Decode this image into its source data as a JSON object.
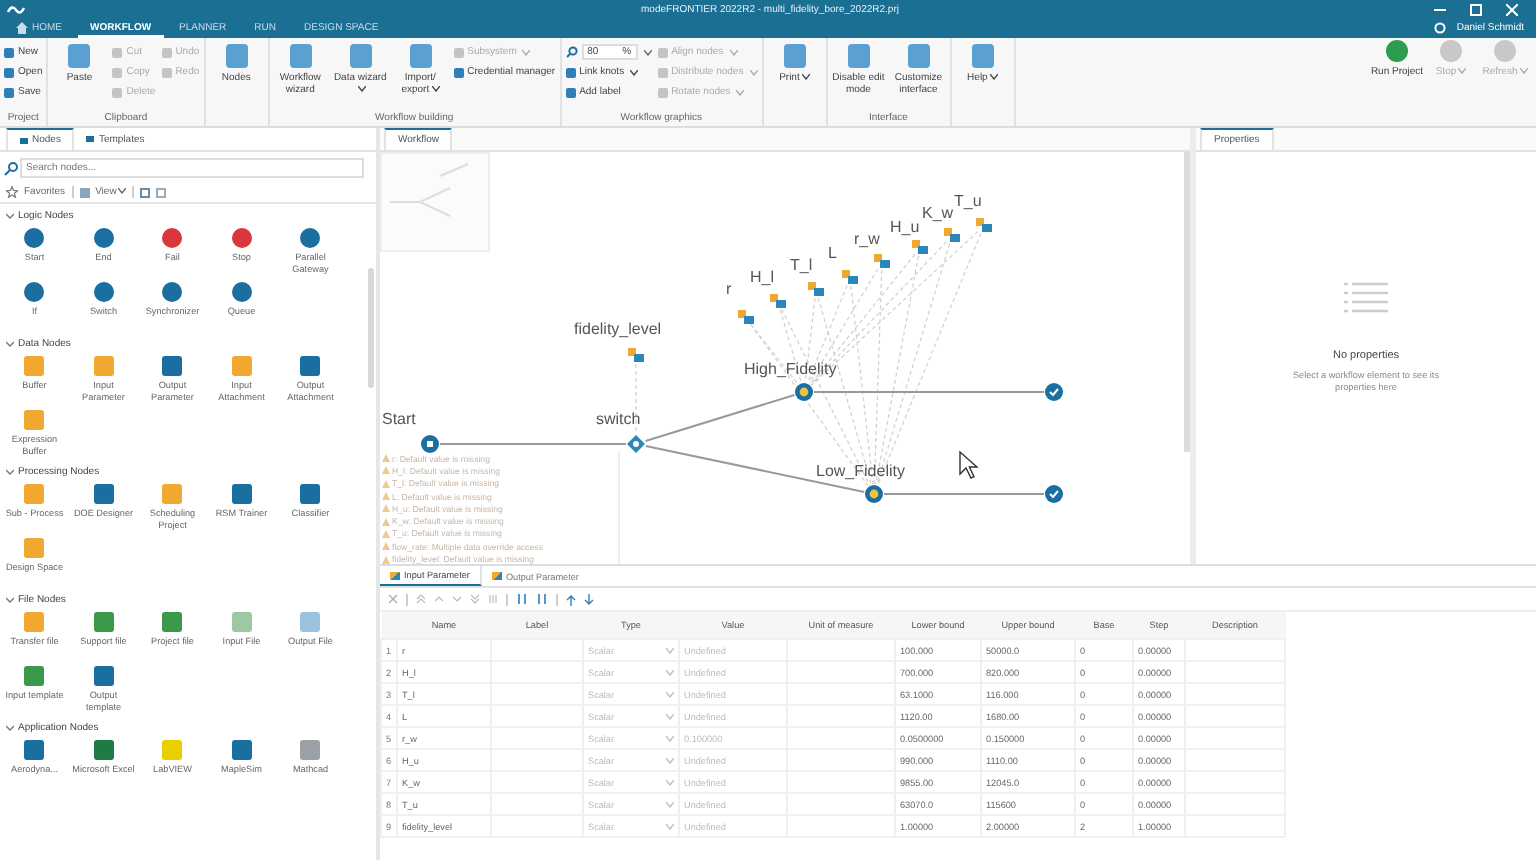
{
  "window": {
    "title": "modeFRONTIER 2022R2 - multi_fidelity_bore_2022R2.prj"
  },
  "menu_tabs": [
    {
      "label": "HOME",
      "selected": false
    },
    {
      "label": "WORKFLOW",
      "selected": true
    },
    {
      "label": "PLANNER",
      "selected": false
    },
    {
      "label": "RUN",
      "selected": false
    },
    {
      "label": "DESIGN SPACE",
      "selected": false
    }
  ],
  "user": {
    "name": "Daniel Schmidt"
  },
  "ribbon": {
    "groups": [
      {
        "label": "Project",
        "items": [
          {
            "kind": "small",
            "label": "New",
            "disabled": false
          },
          {
            "kind": "small",
            "label": "Open",
            "disabled": false
          },
          {
            "kind": "small",
            "label": "Save",
            "disabled": false
          }
        ]
      },
      {
        "label": "Clipboard",
        "items": [
          {
            "kind": "large",
            "label": "Paste",
            "disabled": false
          },
          {
            "kind": "small",
            "label": "Cut",
            "disabled": true
          },
          {
            "kind": "small",
            "label": "Copy",
            "disabled": true
          },
          {
            "kind": "small",
            "label": "Delete",
            "disabled": true
          },
          {
            "kind": "small",
            "label": "Undo",
            "disabled": true
          },
          {
            "kind": "small",
            "label": "Redo",
            "disabled": true
          }
        ]
      },
      {
        "items": [
          {
            "kind": "large",
            "label": "Nodes",
            "disabled": false
          }
        ]
      },
      {
        "label": "Workflow building",
        "items": [
          {
            "kind": "large",
            "label": "Workflow wizard",
            "disabled": false
          },
          {
            "kind": "large",
            "label": "Data wizard",
            "disabled": false,
            "dropdown": true
          },
          {
            "kind": "large",
            "label": "Import/ export",
            "disabled": false,
            "dropdown": true
          },
          {
            "kind": "small",
            "label": "Subsystem",
            "disabled": true,
            "dropdown": true
          },
          {
            "kind": "small",
            "label": "Credential manager",
            "disabled": false
          }
        ]
      },
      {
        "label": "Workflow graphics",
        "items": [
          {
            "kind": "zoom",
            "value": "80",
            "unit": "%",
            "disabled": false,
            "dropdown": true
          },
          {
            "kind": "small",
            "label": "Link knots",
            "disabled": false,
            "dropdown": true
          },
          {
            "kind": "small",
            "label": "Add label",
            "disabled": false
          },
          {
            "kind": "small",
            "label": "Align nodes",
            "disabled": true,
            "dropdown": true
          },
          {
            "kind": "small",
            "label": "Distribute nodes",
            "disabled": true,
            "dropdown": true
          },
          {
            "kind": "small",
            "label": "Rotate nodes",
            "disabled": true,
            "dropdown": true
          }
        ]
      },
      {
        "items": [
          {
            "kind": "large",
            "label": "Print",
            "disabled": false,
            "dropdown": true
          }
        ]
      },
      {
        "label": "Interface",
        "items": [
          {
            "kind": "large",
            "label": "Disable edit mode",
            "disabled": false
          },
          {
            "kind": "large",
            "label": "Customize interface",
            "disabled": false
          }
        ]
      },
      {
        "items": [
          {
            "kind": "large",
            "label": "Help",
            "disabled": false,
            "dropdown": true
          }
        ]
      }
    ],
    "run_controls": [
      {
        "label": "Run Project",
        "disabled": false
      },
      {
        "label": "Stop",
        "disabled": true,
        "dropdown": true
      },
      {
        "label": "Refresh",
        "disabled": true,
        "dropdown": true
      }
    ]
  },
  "node_panel": {
    "tabs": [
      {
        "label": "Nodes",
        "selected": true
      },
      {
        "label": "Templates",
        "selected": false
      }
    ],
    "search": {
      "placeholder": "Search nodes..."
    },
    "toolbar": {
      "favorites": "Favorites",
      "view": "View"
    },
    "sections": [
      {
        "title": "Logic Nodes",
        "expanded": true,
        "nodes": [
          {
            "label": "Start",
            "color": "#1a6fa0"
          },
          {
            "label": "End",
            "color": "#1a6fa0"
          },
          {
            "label": "Fail",
            "color": "#d9363e"
          },
          {
            "label": "Stop",
            "color": "#d9363e"
          },
          {
            "label": "Parallel Gateway",
            "color": "#1a6fa0"
          },
          {
            "label": "If",
            "color": "#1a6fa0"
          },
          {
            "label": "Switch",
            "color": "#1a6fa0"
          },
          {
            "label": "Synchronizer",
            "color": "#1a6fa0"
          },
          {
            "label": "Queue",
            "color": "#1a6fa0"
          }
        ]
      },
      {
        "title": "Data Nodes",
        "expanded": true,
        "nodes": [
          {
            "label": "Buffer",
            "color": "#f0a830"
          },
          {
            "label": "Input Parameter",
            "color": "#f0a830"
          },
          {
            "label": "Output Parameter",
            "color": "#1a6fa0"
          },
          {
            "label": "Input Attachment",
            "color": "#f0a830"
          },
          {
            "label": "Output Attachment",
            "color": "#1a6fa0"
          },
          {
            "label": "Expression Buffer",
            "color": "#f0a830"
          }
        ]
      },
      {
        "title": "Processing Nodes",
        "expanded": true,
        "nodes": [
          {
            "label": "Sub - Process",
            "color": "#f0a830"
          },
          {
            "label": "DOE Designer",
            "color": "#1a6fa0"
          },
          {
            "label": "Scheduling Project",
            "color": "#f0a830"
          },
          {
            "label": "RSM Trainer",
            "color": "#1a6fa0"
          },
          {
            "label": "Classifier",
            "color": "#1a6fa0"
          },
          {
            "label": "Design Space",
            "color": "#f0a830"
          }
        ]
      },
      {
        "title": "File Nodes",
        "expanded": true,
        "nodes": [
          {
            "label": "Transfer file",
            "color": "#f0a830"
          },
          {
            "label": "Support file",
            "color": "#3a9a4a"
          },
          {
            "label": "Project file",
            "color": "#3a9a4a"
          },
          {
            "label": "Input File",
            "color": "#9cc9a0"
          },
          {
            "label": "Output File",
            "color": "#9cc3de"
          },
          {
            "label": "Input template",
            "color": "#3a9a4a"
          },
          {
            "label": "Output template",
            "color": "#1a6fa0"
          }
        ]
      },
      {
        "title": "Application Nodes",
        "expanded": true,
        "nodes": [
          {
            "label": "Aerodyna...",
            "color": "#1a6fa0"
          },
          {
            "label": "Microsoft Excel",
            "color": "#1e7b45"
          },
          {
            "label": "LabVIEW",
            "color": "#e8d000"
          },
          {
            "label": "MapleSim",
            "color": "#1a6fa0"
          },
          {
            "label": "Mathcad",
            "color": "#9aa0a6"
          }
        ]
      }
    ]
  },
  "workflow": {
    "tab": "Workflow",
    "nodes": [
      {
        "kind": "start",
        "label": "Start"
      },
      {
        "kind": "switch",
        "label": "switch"
      },
      {
        "kind": "parameter",
        "label": "fidelity_level"
      },
      {
        "kind": "parameter",
        "label": "r"
      },
      {
        "kind": "parameter",
        "label": "H_l"
      },
      {
        "kind": "parameter",
        "label": "T_l"
      },
      {
        "kind": "parameter",
        "label": "L"
      },
      {
        "kind": "parameter",
        "label": "r_w"
      },
      {
        "kind": "parameter",
        "label": "H_u"
      },
      {
        "kind": "parameter",
        "label": "K_w"
      },
      {
        "kind": "parameter",
        "label": "T_u"
      },
      {
        "kind": "process",
        "label": "High_Fidelity"
      },
      {
        "kind": "process",
        "label": "Low_Fidelity"
      },
      {
        "kind": "end"
      },
      {
        "kind": "end"
      }
    ],
    "messages": [
      "r: Default value is missing",
      "H_l: Default value is missing",
      "T_l: Default value is missing",
      "L: Default value is missing",
      "H_u: Default value is missing",
      "K_w: Default value is missing",
      "T_u: Default value is missing",
      "flow_rate: Multiple data override access",
      "fidelity_level: Default value is missing"
    ]
  },
  "properties": {
    "tab": "Properties",
    "title": "No properties",
    "hint": "Select a workflow element to see its properties here"
  },
  "parameters": {
    "tabs": [
      {
        "label": "Input Parameter",
        "selected": true
      },
      {
        "label": "Output Parameter",
        "selected": false
      }
    ],
    "columns": [
      "Name",
      "Label",
      "Type",
      "Value",
      "Unit of measure",
      "Lower bound",
      "Upper bound",
      "Base",
      "Step",
      "Description"
    ],
    "rows": [
      {
        "index": "1",
        "name": "r",
        "type": "Scalar",
        "value": "Undefined",
        "lower": "100.000",
        "upper": "50000.0",
        "base": "0",
        "step": "0.00000"
      },
      {
        "index": "2",
        "name": "H_l",
        "type": "Scalar",
        "value": "Undefined",
        "lower": "700.000",
        "upper": "820.000",
        "base": "0",
        "step": "0.00000"
      },
      {
        "index": "3",
        "name": "T_l",
        "type": "Scalar",
        "value": "Undefined",
        "lower": "63.1000",
        "upper": "116.000",
        "base": "0",
        "step": "0.00000"
      },
      {
        "index": "4",
        "name": "L",
        "type": "Scalar",
        "value": "Undefined",
        "lower": "1120.00",
        "upper": "1680.00",
        "base": "0",
        "step": "0.00000"
      },
      {
        "index": "5",
        "name": "r_w",
        "type": "Scalar",
        "value": "0.100000",
        "lower": "0.0500000",
        "upper": "0.150000",
        "base": "0",
        "step": "0.00000"
      },
      {
        "index": "6",
        "name": "H_u",
        "type": "Scalar",
        "value": "Undefined",
        "lower": "990.000",
        "upper": "1110.00",
        "base": "0",
        "step": "0.00000"
      },
      {
        "index": "7",
        "name": "K_w",
        "type": "Scalar",
        "value": "Undefined",
        "lower": "9855.00",
        "upper": "12045.0",
        "base": "0",
        "step": "0.00000"
      },
      {
        "index": "8",
        "name": "T_u",
        "type": "Scalar",
        "value": "Undefined",
        "lower": "63070.0",
        "upper": "115600",
        "base": "0",
        "step": "0.00000"
      },
      {
        "index": "9",
        "name": "fidelity_level",
        "type": "Scalar",
        "value": "Undefined",
        "lower": "1.00000",
        "upper": "2.00000",
        "base": "2",
        "step": "1.00000"
      }
    ]
  }
}
